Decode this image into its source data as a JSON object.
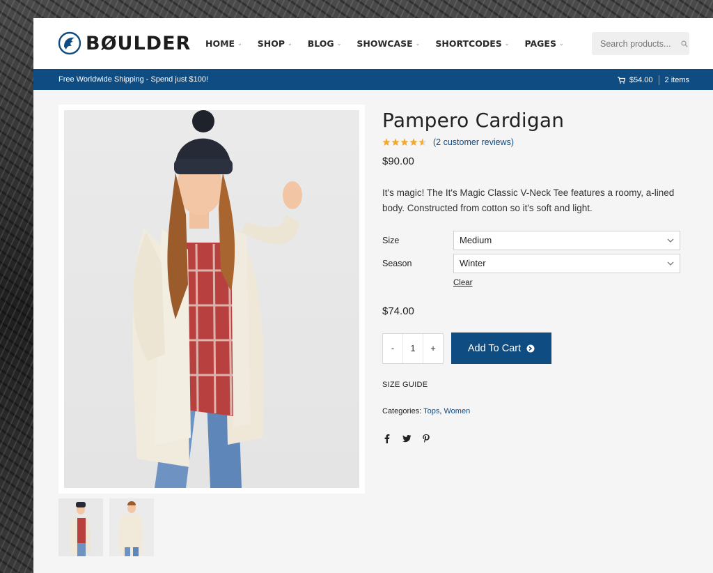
{
  "brand": {
    "name": "BØULDER",
    "logo_icon": "lion-head-icon",
    "color": "#0f4c81"
  },
  "nav": [
    {
      "label": "HOME"
    },
    {
      "label": "SHOP"
    },
    {
      "label": "BLOG"
    },
    {
      "label": "SHOWCASE"
    },
    {
      "label": "SHORTCODES"
    },
    {
      "label": "PAGES"
    }
  ],
  "search": {
    "placeholder": "Search products...",
    "icon": "search-icon"
  },
  "promo_bar": {
    "message": "Free Worldwide Shipping - Spend just $100!",
    "cart_total": "$54.00",
    "cart_count": "2 items",
    "cart_icon": "cart-icon"
  },
  "product": {
    "title": "Pampero Cardigan",
    "rating": {
      "value": 4.5,
      "max": 5,
      "reviews_text": "(2 customer reviews)"
    },
    "price": "$90.00",
    "description": "It's magic! The It's Magic Classic V-Neck Tee features a roomy, a-lined body. Constructed from cotton so it's soft and light.",
    "variations": [
      {
        "label": "Size",
        "selected": "Medium"
      },
      {
        "label": "Season",
        "selected": "Winter"
      }
    ],
    "clear_label": "Clear",
    "variation_price": "$74.00",
    "quantity": {
      "minus": "-",
      "value": "1",
      "plus": "+"
    },
    "add_to_cart": "Add To Cart",
    "size_guide": "SIZE GUIDE",
    "categories_label": "Categories:",
    "categories": [
      "Tops",
      "Women"
    ],
    "share_icons": [
      "facebook-icon",
      "twitter-icon",
      "pinterest-icon"
    ]
  },
  "colors": {
    "accent": "#0f4c81",
    "star": "#f0a830",
    "page_bg": "#f5f5f5"
  }
}
